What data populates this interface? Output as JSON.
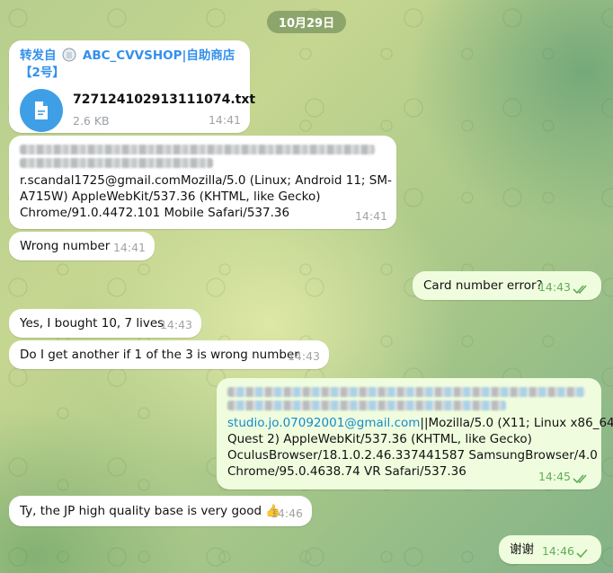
{
  "date_label": "10月29日",
  "colors": {
    "accent": "#3390ec",
    "outgoing_bubble": "#effdde",
    "incoming_bubble": "#ffffff",
    "tick": "#5fae57"
  },
  "forwarded": {
    "prefix": "转发自",
    "source_line1": "ABC_CVVSHOP|自助商店",
    "source_line2": "【2号】",
    "file_name": "727124102913111074.txt",
    "file_size": "2.6 KB",
    "file_icon": "document-icon",
    "time": "14:41"
  },
  "messages": [
    {
      "id": "ua",
      "direction": "in",
      "lines": [
        "r.scandal1725@gmail.comMozilla/5.0 (Linux; Android 11; SM-",
        "A715W) AppleWebKit/537.36 (KHTML, like Gecko)",
        "Chrome/91.0.4472.101 Mobile Safari/537.36"
      ],
      "time": "14:41"
    },
    {
      "id": "wrong",
      "direction": "in",
      "text": "Wrong number",
      "time": "14:41"
    },
    {
      "id": "card-err",
      "direction": "out",
      "text": "Card number error?",
      "time": "14:43",
      "status": "read"
    },
    {
      "id": "bought",
      "direction": "in",
      "text": "Yes, I bought 10, 7 lives",
      "time": "14:43"
    },
    {
      "id": "another",
      "direction": "in",
      "text": "Do I get another if 1 of the 3 is wrong number",
      "time": "14:43"
    },
    {
      "id": "ua2",
      "direction": "out",
      "link": "studio.jo.07092001@gmail.com",
      "first_line_rest": "||Mozilla/5.0 (X11; Linux x86_64;",
      "lines": [
        "Quest 2) AppleWebKit/537.36 (KHTML, like Gecko)",
        "OculusBrowser/18.1.0.2.46.337441587 SamsungBrowser/4.0",
        "Chrome/95.0.4638.74 VR Safari/537.36"
      ],
      "time": "14:45",
      "status": "read"
    },
    {
      "id": "ty",
      "direction": "in",
      "text": "Ty, the JP high quality base is very good",
      "emoji": "👍",
      "time": "14:46"
    },
    {
      "id": "thanks",
      "direction": "out",
      "text": "谢谢",
      "time": "14:46",
      "status": "sent"
    }
  ]
}
